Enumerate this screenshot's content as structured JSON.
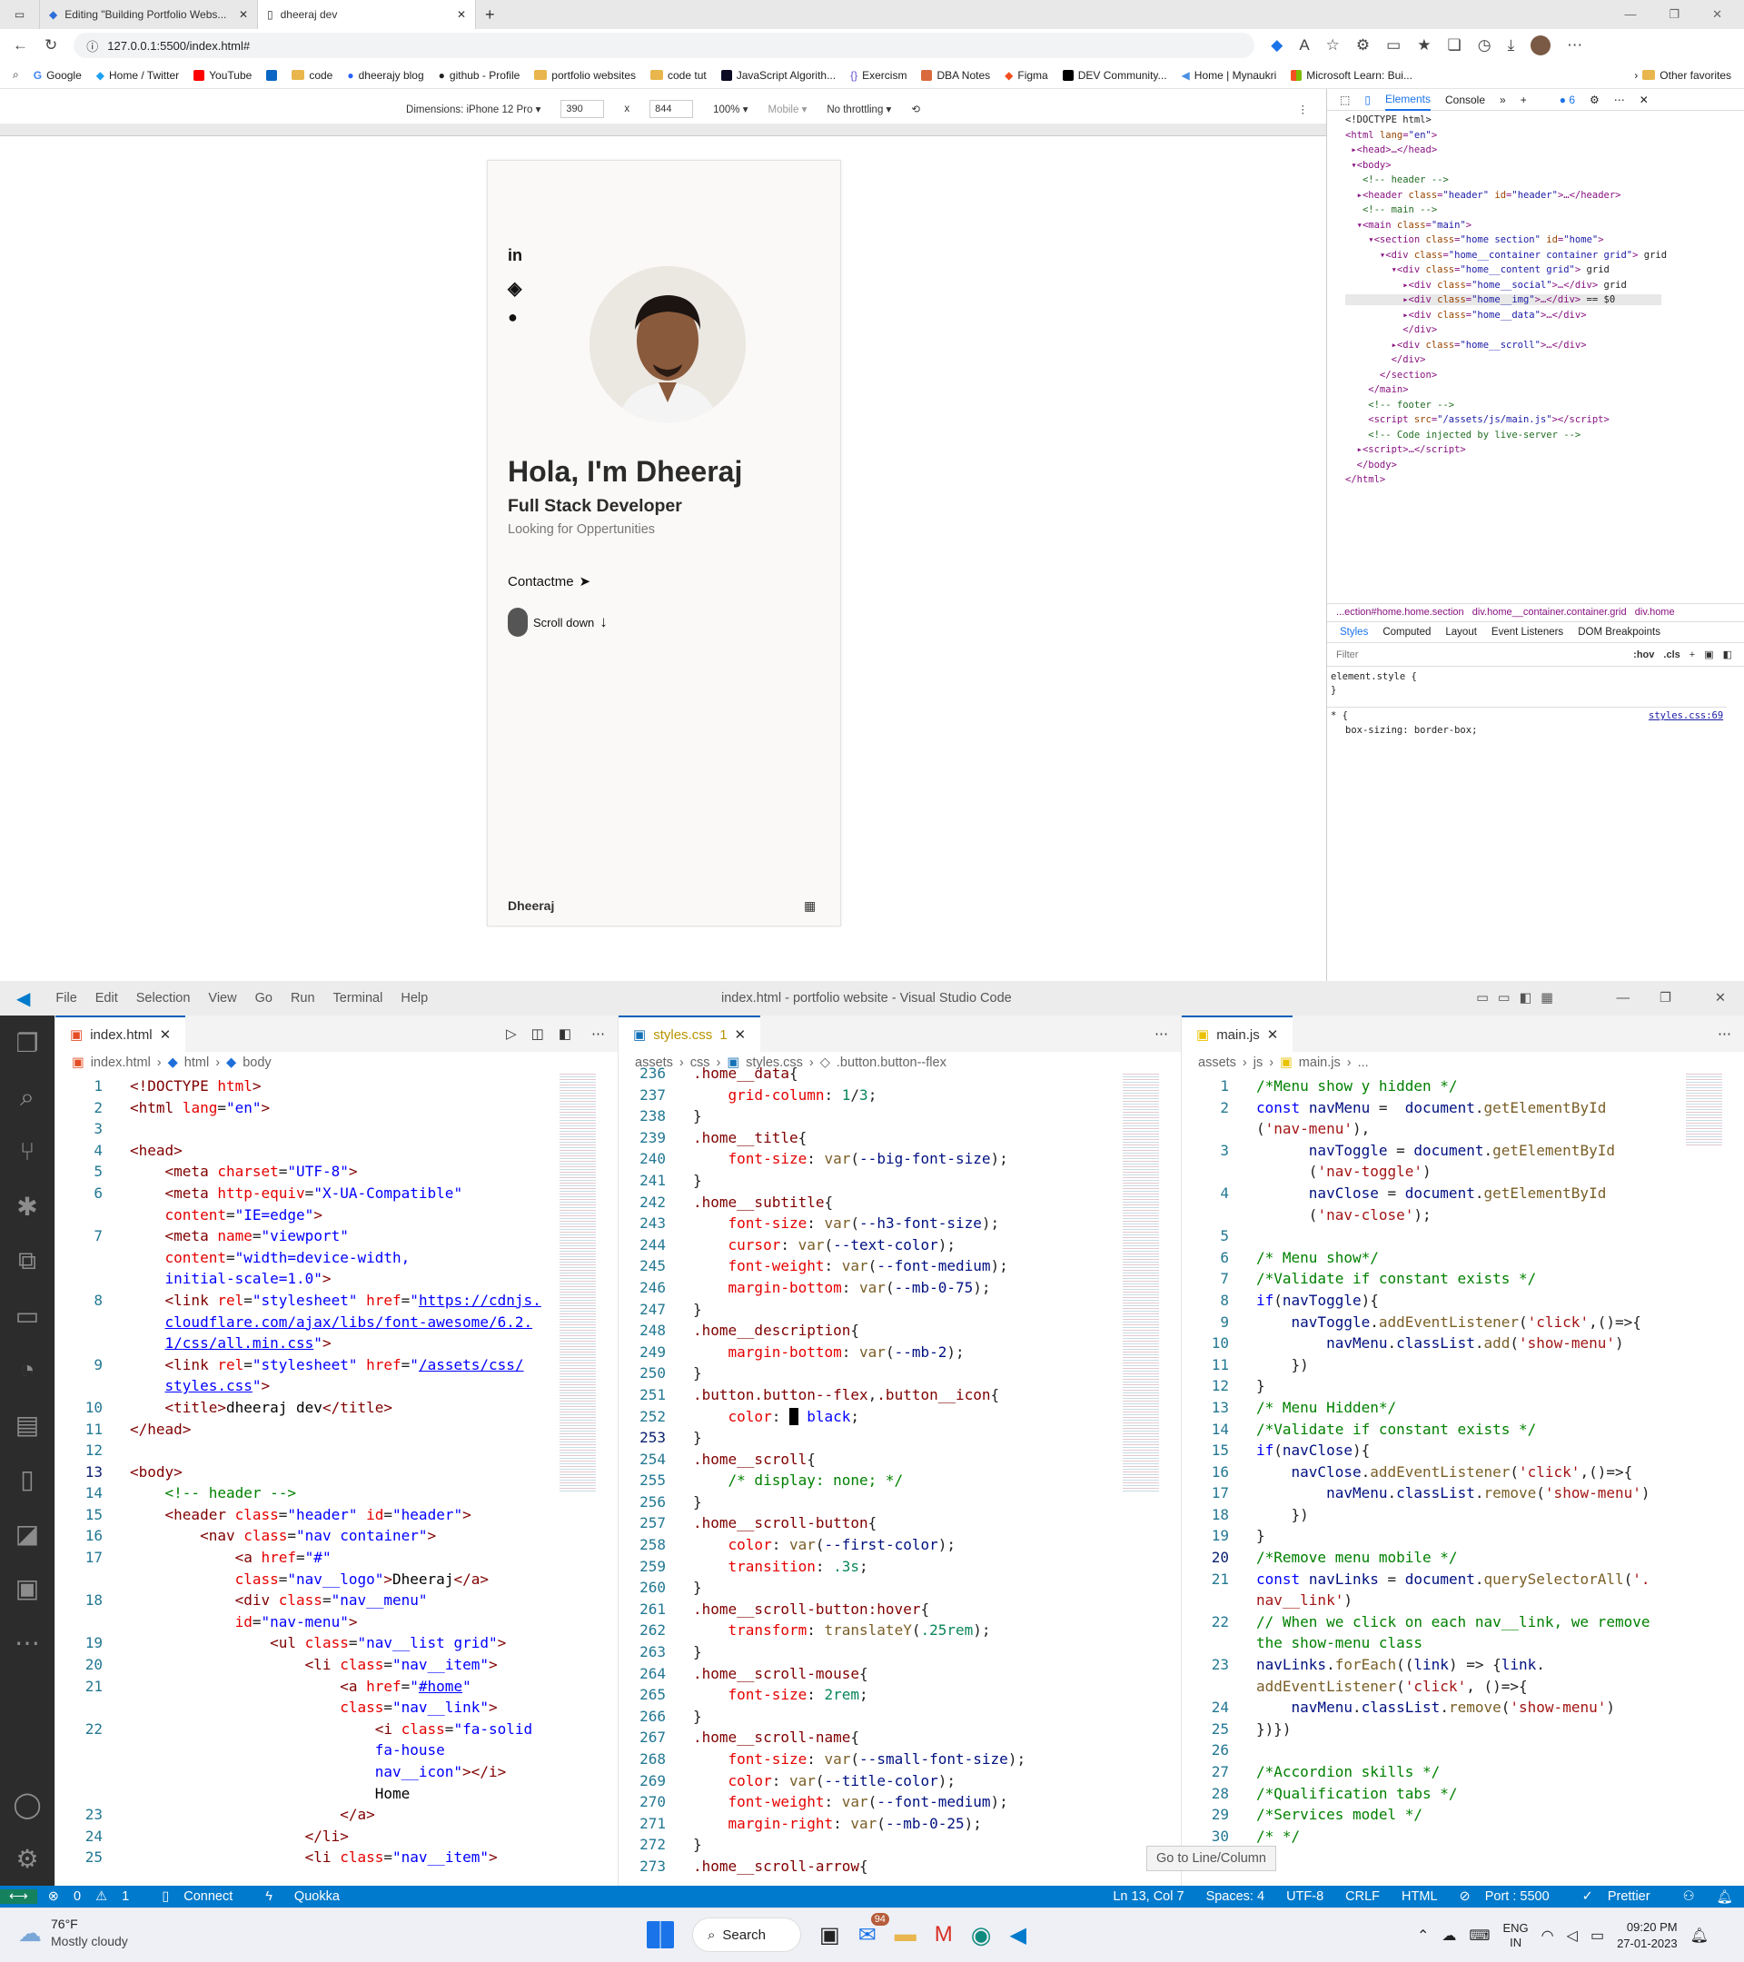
{
  "browser": {
    "tabs": [
      {
        "title": "Editing \"Building Portfolio Webs...",
        "active": false
      },
      {
        "title": "dheeraj dev",
        "active": true
      }
    ],
    "url": "127.0.0.1:5500/index.html#",
    "bookmarks": [
      "Google",
      "Home / Twitter",
      "YouTube",
      "code",
      "dheerajy blog",
      "github - Profile",
      "portfolio websites",
      "code tut",
      "JavaScript Algorith...",
      "Exercism",
      "DBA Notes",
      "Figma",
      "DEV Community...",
      "Home | Mynaukri",
      "Microsoft Learn: Bui..."
    ],
    "other_favorites": "Other favorites",
    "device_toolbar": {
      "dimensions": "Dimensions: iPhone 12 Pro",
      "width": "390",
      "x": "x",
      "height": "844",
      "zoom": "100%",
      "mode": "Mobile",
      "throttle": "No throttling"
    }
  },
  "portfolio": {
    "title": "Hola, I'm Dheeraj",
    "subtitle": "Full Stack Developer",
    "description": "Looking for Oppertunities",
    "contact": "Contactme",
    "scroll": "Scroll down",
    "logo": "Dheeraj",
    "social_icons": [
      "linkedin-icon",
      "dribbble-icon",
      "github-icon"
    ]
  },
  "devtools": {
    "tabs": [
      "Elements",
      "Console"
    ],
    "issues": "6",
    "breadcrumb": "...ection#home.home.section   div.home__container.container.grid   div.home",
    "styles_tabs": [
      "Styles",
      "Computed",
      "Layout",
      "Event Listeners",
      "DOM Breakpoints"
    ],
    "filter": "Filter",
    "hov": ":hov",
    "cls": ".cls",
    "element_style": "element.style {",
    "element_style_close": "}",
    "rule_selector": "* {",
    "rule_source": "styles.css:69",
    "rule_decl": "box-sizing: border-box;"
  },
  "vscode": {
    "title": "index.html - portfolio website - Visual Studio Code",
    "menu": [
      "File",
      "Edit",
      "Selection",
      "View",
      "Go",
      "Run",
      "Terminal",
      "Help"
    ],
    "panes": [
      {
        "tab": "index.html",
        "breadcrumb": [
          "index.html",
          "html",
          "body"
        ]
      },
      {
        "tab": "styles.css",
        "tab_badge": "1",
        "breadcrumb": [
          "assets",
          "css",
          "styles.css",
          ".button.button--flex"
        ]
      },
      {
        "tab": "main.js",
        "breadcrumb": [
          "assets",
          "js",
          "main.js",
          "..."
        ]
      }
    ],
    "tooltip": "Go to Line/Column",
    "status": {
      "errors": "0",
      "warnings": "1",
      "connect": "Connect",
      "quokka": "Quokka",
      "position": "Ln 13, Col 7",
      "spaces": "Spaces: 4",
      "encoding": "UTF-8",
      "eol": "CRLF",
      "lang": "HTML",
      "port": "Port : 5500",
      "prettier": "Prettier"
    }
  },
  "taskbar": {
    "temp": "76°F",
    "weather": "Mostly cloudy",
    "search": "Search",
    "mail_badge": "94",
    "lang1": "ENG",
    "lang2": "IN",
    "time": "09:20 PM",
    "date": "27-01-2023"
  }
}
